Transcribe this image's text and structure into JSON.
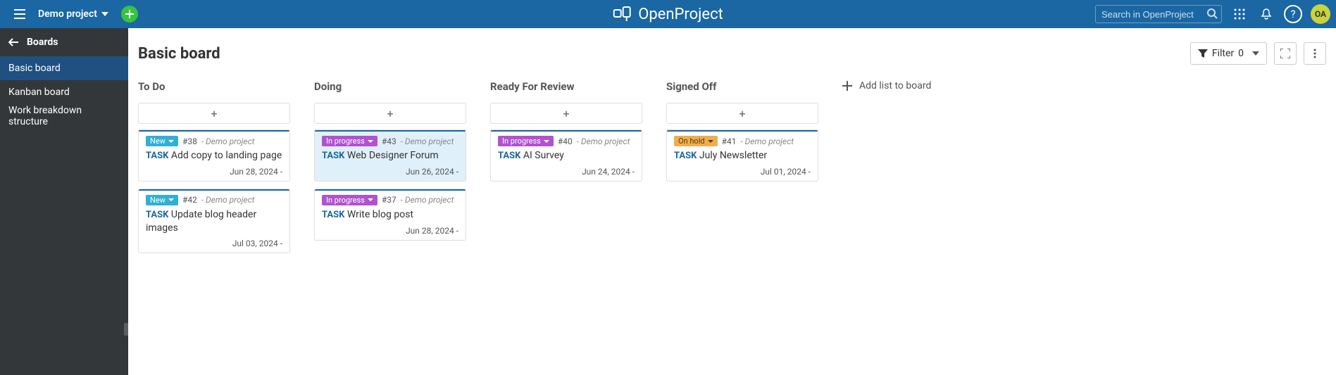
{
  "header": {
    "project": "Demo project",
    "app_name": "OpenProject",
    "search_placeholder": "Search in OpenProject",
    "avatar_initials": "OA"
  },
  "sidebar": {
    "title": "Boards",
    "items": [
      {
        "label": "Basic board"
      },
      {
        "label": "Kanban board"
      },
      {
        "label": "Work breakdown structure"
      }
    ]
  },
  "board": {
    "title": "Basic board",
    "filter_label": "Filter",
    "filter_count": "0",
    "add_list_label": "Add list to board"
  },
  "columns": [
    {
      "title": "To Do",
      "cards": [
        {
          "status": "New",
          "status_kind": "new",
          "id": "#38",
          "project": "Demo project",
          "task_label": "TASK",
          "title": "Add copy to landing page",
          "date": "Jun 28, 2024 -",
          "selected": false
        },
        {
          "status": "New",
          "status_kind": "new",
          "id": "#42",
          "project": "Demo project",
          "task_label": "TASK",
          "title": "Update blog header images",
          "date": "Jul 03, 2024 -",
          "selected": false
        }
      ]
    },
    {
      "title": "Doing",
      "cards": [
        {
          "status": "In progress",
          "status_kind": "progress",
          "id": "#43",
          "project": "Demo project",
          "task_label": "TASK",
          "title": "Web Designer Forum",
          "date": "Jun 26, 2024 -",
          "selected": true
        },
        {
          "status": "In progress",
          "status_kind": "progress",
          "id": "#37",
          "project": "Demo project",
          "task_label": "TASK",
          "title": "Write blog post",
          "date": "Jun 28, 2024 -",
          "selected": false
        }
      ]
    },
    {
      "title": "Ready For Review",
      "cards": [
        {
          "status": "In progress",
          "status_kind": "progress",
          "id": "#40",
          "project": "Demo project",
          "task_label": "TASK",
          "title": "AI Survey",
          "date": "Jun 24, 2024 -",
          "selected": false
        }
      ]
    },
    {
      "title": "Signed Off",
      "cards": [
        {
          "status": "On hold",
          "status_kind": "hold",
          "id": "#41",
          "project": "Demo project",
          "task_label": "TASK",
          "title": "July Newsletter",
          "date": "Jul 01, 2024 -",
          "selected": false
        }
      ]
    }
  ]
}
